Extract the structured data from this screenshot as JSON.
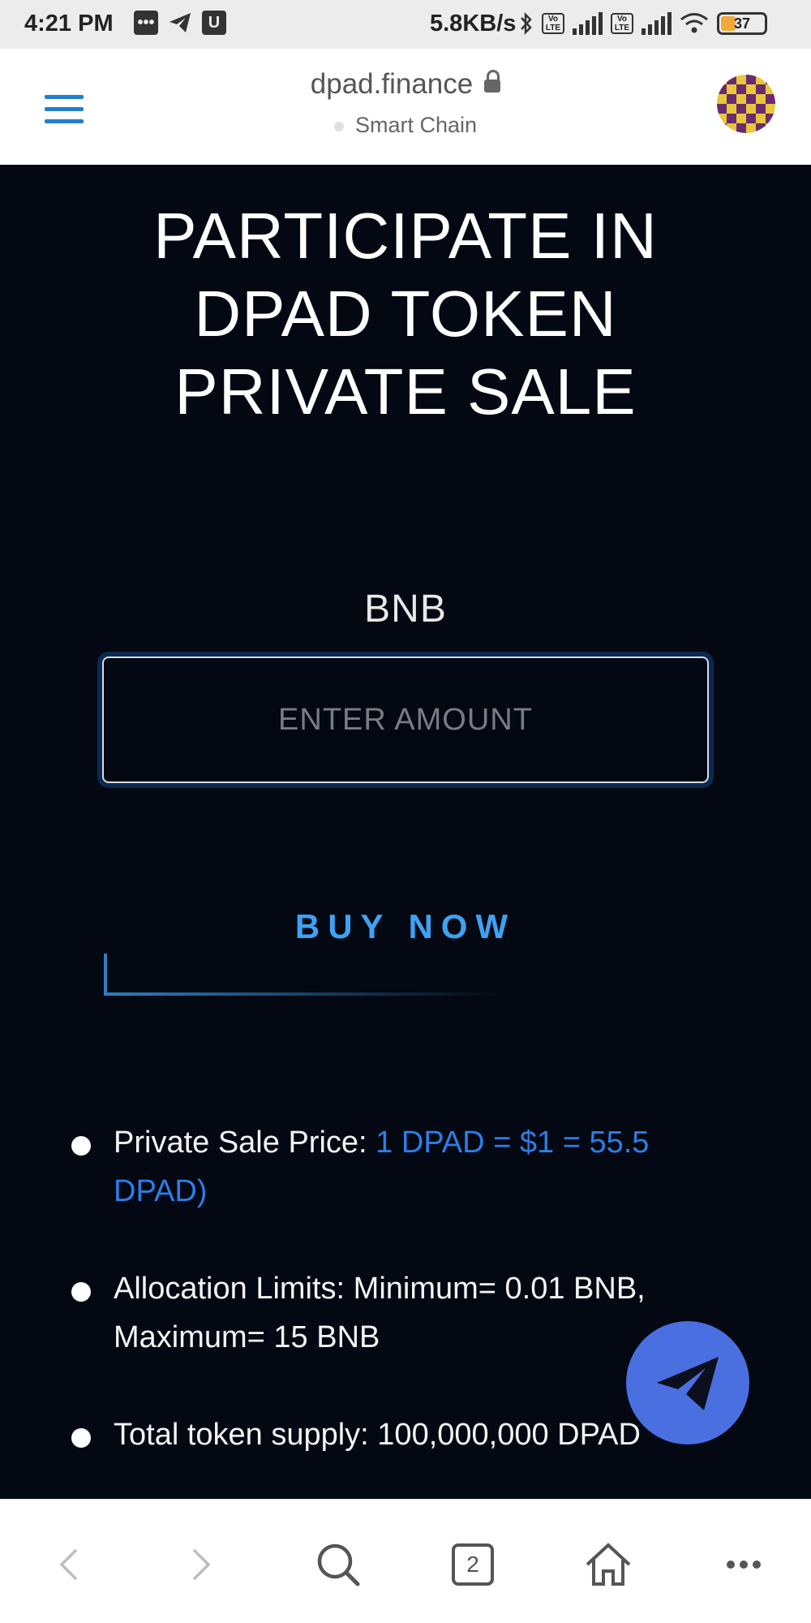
{
  "status_bar": {
    "time": "4:21 PM",
    "left_icons": [
      "messages-icon",
      "telegram-icon",
      "u-app-icon"
    ],
    "network_rate": "5.8KB/s",
    "battery": "37",
    "battery_fraction": 0.37,
    "lte_label": "Vo\nLTE"
  },
  "browser": {
    "url": "dpad.finance",
    "network": "Smart Chain"
  },
  "page": {
    "headline": "PARTICIPATE IN DPAD TOKEN PRIVATE SALE",
    "currency_label": "BNB",
    "amount_placeholder": "ENTER AMOUNT",
    "amount_value": "",
    "buy_label": "BUY NOW",
    "info": [
      {
        "label": "Private Sale Price: ",
        "highlight": "1 DPAD = $1 = 55.5 DPAD)"
      },
      {
        "label": "Allocation Limits: Minimum= 0.01 BNB, Maximum= 15 BNB",
        "highlight": ""
      },
      {
        "label": "Total token supply: 100,000,000 DPAD",
        "highlight": ""
      }
    ]
  },
  "bottom_nav": {
    "tab_count": "2"
  },
  "colors": {
    "page_bg": "#030812",
    "accent_blue": "#3ea2f3",
    "highlight_blue": "#2b7ee6",
    "fab_blue": "#4a6fe0"
  }
}
